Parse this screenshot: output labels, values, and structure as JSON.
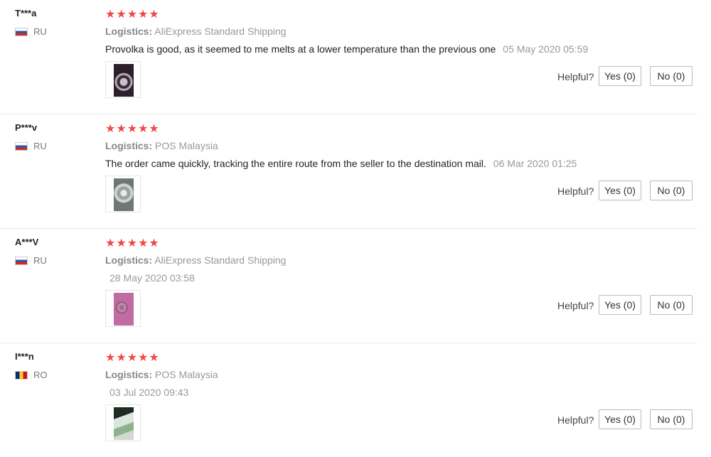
{
  "labels": {
    "logistics": "Logistics:",
    "helpful": "Helpful?"
  },
  "reviews": [
    {
      "user": "T***a",
      "country": "RU",
      "stars": "★★★★★",
      "shipping": "AliExpress Standard Shipping",
      "comment": "Provolka is good, as it seemed to me melts at a lower temperature than the previous one",
      "date": "05 May 2020 05:59",
      "yes": "Yes (0)",
      "no": "No (0)"
    },
    {
      "user": "P***v",
      "country": "RU",
      "stars": "★★★★★",
      "shipping": "POS Malaysia",
      "comment": "The order came quickly, tracking the entire route from the seller to the destination mail.",
      "date": "06 Mar 2020 01:25",
      "yes": "Yes (0)",
      "no": "No (0)"
    },
    {
      "user": "A***V",
      "country": "RU",
      "stars": "★★★★★",
      "shipping": "AliExpress Standard Shipping",
      "comment": "",
      "date": "28 May 2020 03:58",
      "yes": "Yes (0)",
      "no": "No (0)"
    },
    {
      "user": "I***n",
      "country": "RO",
      "stars": "★★★★★",
      "shipping": "POS Malaysia",
      "comment": "",
      "date": "03 Jul 2020 09:43",
      "yes": "Yes (0)",
      "no": "No (0)"
    }
  ]
}
